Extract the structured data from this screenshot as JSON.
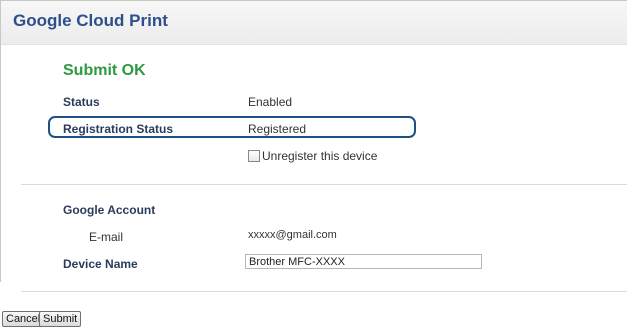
{
  "header": {
    "title": "Google Cloud Print"
  },
  "message": {
    "text": "Submit OK"
  },
  "status": {
    "label": "Status",
    "value": "Enabled"
  },
  "registration": {
    "label": "Registration Status",
    "value": "Registered",
    "unregister_label": "Unregister this device",
    "unregister_checked": false
  },
  "account": {
    "section_label": "Google Account",
    "email_label": "E-mail",
    "email_value": "xxxxx@gmail.com"
  },
  "device": {
    "label": "Device Name",
    "value": "Brother MFC-XXXX"
  },
  "buttons": {
    "cancel": "Cancel",
    "submit": "Submit"
  },
  "colors": {
    "title": "#2d4f8c",
    "success": "#2e9a3f",
    "highlight_border": "#1e4f86",
    "label": "#2a3c5c"
  }
}
